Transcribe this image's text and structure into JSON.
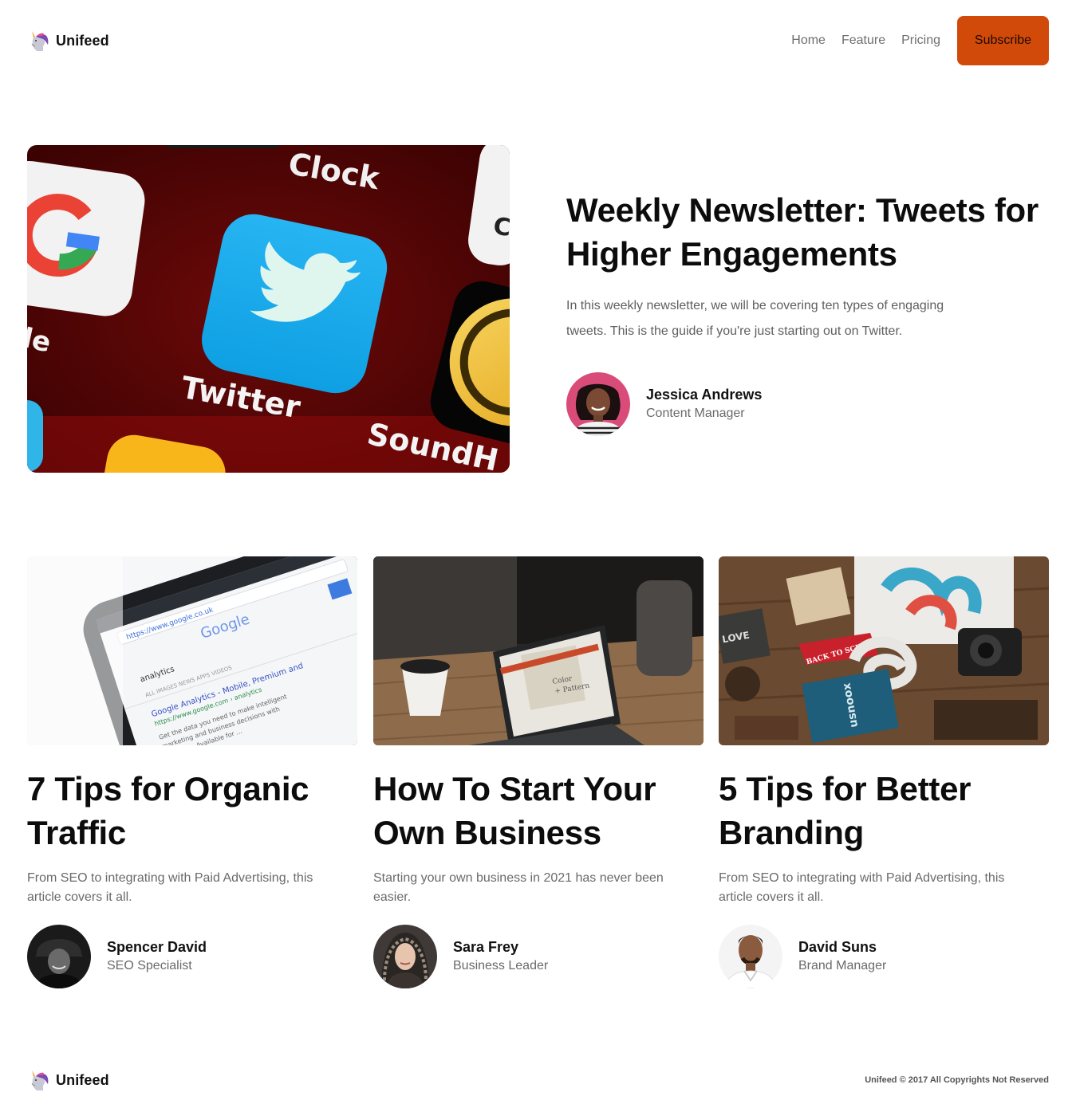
{
  "header": {
    "brand": "Unifeed",
    "nav": [
      "Home",
      "Feature",
      "Pricing"
    ],
    "cta": "Subscribe"
  },
  "hero": {
    "title": "Weekly Newsletter: Tweets for Higher Engagements",
    "description": "In this weekly newsletter, we will be covering ten types of engaging tweets. This is the guide if you're just starting out on Twitter.",
    "image_labels": [
      "Clock",
      "Twitter",
      "SoundH"
    ],
    "author": {
      "name": "Jessica Andrews",
      "role": "Content Manager"
    }
  },
  "cards": [
    {
      "title": "7 Tips for Organic Traffic",
      "description": "From SEO to integrating with Paid Advertising, this article covers it all.",
      "author": {
        "name": "Spencer David",
        "role": "SEO Specialist"
      }
    },
    {
      "title": "How To Start Your Own Business",
      "description": "Starting your own business in 2021 has never been easier.",
      "author": {
        "name": "Sara Frey",
        "role": "Business Leader"
      }
    },
    {
      "title": "5 Tips for Better Branding",
      "description": "From SEO to integrating with Paid Advertising, this article covers it all.",
      "author": {
        "name": "David Suns",
        "role": "Brand Manager"
      }
    }
  ],
  "footer": {
    "brand": "Unifeed",
    "copyright": "Unifeed © 2017 All Copyrights Not Reserved"
  },
  "colors": {
    "accent": "#d24a0a",
    "text": "#0c0c0c",
    "muted": "#6a6a6a"
  },
  "icons": {
    "logo": "unicorn-icon"
  }
}
